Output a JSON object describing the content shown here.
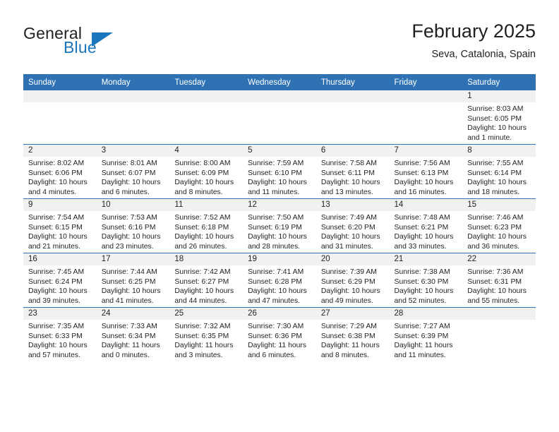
{
  "brand": {
    "name_part1": "General",
    "name_part2": "Blue",
    "triangle_color": "#1b76bc"
  },
  "header": {
    "title": "February 2025",
    "subtitle": "Seva, Catalonia, Spain"
  },
  "theme": {
    "header_bg": "#2f72b4",
    "daynum_bg": "#f1f1f1",
    "text": "#231f20",
    "grid_line": "#2f72b4"
  },
  "weekdays": [
    "Sunday",
    "Monday",
    "Tuesday",
    "Wednesday",
    "Thursday",
    "Friday",
    "Saturday"
  ],
  "labels": {
    "sunrise": "Sunrise:",
    "sunset": "Sunset:",
    "daylight": "Daylight:"
  },
  "weeks": [
    [
      {
        "empty": true
      },
      {
        "empty": true
      },
      {
        "empty": true
      },
      {
        "empty": true
      },
      {
        "empty": true
      },
      {
        "empty": true
      },
      {
        "day": "1",
        "sunrise": "Sunrise: 8:03 AM",
        "sunset": "Sunset: 6:05 PM",
        "daylight1": "Daylight: 10 hours",
        "daylight2": "and 1 minute."
      }
    ],
    [
      {
        "day": "2",
        "sunrise": "Sunrise: 8:02 AM",
        "sunset": "Sunset: 6:06 PM",
        "daylight1": "Daylight: 10 hours",
        "daylight2": "and 4 minutes."
      },
      {
        "day": "3",
        "sunrise": "Sunrise: 8:01 AM",
        "sunset": "Sunset: 6:07 PM",
        "daylight1": "Daylight: 10 hours",
        "daylight2": "and 6 minutes."
      },
      {
        "day": "4",
        "sunrise": "Sunrise: 8:00 AM",
        "sunset": "Sunset: 6:09 PM",
        "daylight1": "Daylight: 10 hours",
        "daylight2": "and 8 minutes."
      },
      {
        "day": "5",
        "sunrise": "Sunrise: 7:59 AM",
        "sunset": "Sunset: 6:10 PM",
        "daylight1": "Daylight: 10 hours",
        "daylight2": "and 11 minutes."
      },
      {
        "day": "6",
        "sunrise": "Sunrise: 7:58 AM",
        "sunset": "Sunset: 6:11 PM",
        "daylight1": "Daylight: 10 hours",
        "daylight2": "and 13 minutes."
      },
      {
        "day": "7",
        "sunrise": "Sunrise: 7:56 AM",
        "sunset": "Sunset: 6:13 PM",
        "daylight1": "Daylight: 10 hours",
        "daylight2": "and 16 minutes."
      },
      {
        "day": "8",
        "sunrise": "Sunrise: 7:55 AM",
        "sunset": "Sunset: 6:14 PM",
        "daylight1": "Daylight: 10 hours",
        "daylight2": "and 18 minutes."
      }
    ],
    [
      {
        "day": "9",
        "sunrise": "Sunrise: 7:54 AM",
        "sunset": "Sunset: 6:15 PM",
        "daylight1": "Daylight: 10 hours",
        "daylight2": "and 21 minutes."
      },
      {
        "day": "10",
        "sunrise": "Sunrise: 7:53 AM",
        "sunset": "Sunset: 6:16 PM",
        "daylight1": "Daylight: 10 hours",
        "daylight2": "and 23 minutes."
      },
      {
        "day": "11",
        "sunrise": "Sunrise: 7:52 AM",
        "sunset": "Sunset: 6:18 PM",
        "daylight1": "Daylight: 10 hours",
        "daylight2": "and 26 minutes."
      },
      {
        "day": "12",
        "sunrise": "Sunrise: 7:50 AM",
        "sunset": "Sunset: 6:19 PM",
        "daylight1": "Daylight: 10 hours",
        "daylight2": "and 28 minutes."
      },
      {
        "day": "13",
        "sunrise": "Sunrise: 7:49 AM",
        "sunset": "Sunset: 6:20 PM",
        "daylight1": "Daylight: 10 hours",
        "daylight2": "and 31 minutes."
      },
      {
        "day": "14",
        "sunrise": "Sunrise: 7:48 AM",
        "sunset": "Sunset: 6:21 PM",
        "daylight1": "Daylight: 10 hours",
        "daylight2": "and 33 minutes."
      },
      {
        "day": "15",
        "sunrise": "Sunrise: 7:46 AM",
        "sunset": "Sunset: 6:23 PM",
        "daylight1": "Daylight: 10 hours",
        "daylight2": "and 36 minutes."
      }
    ],
    [
      {
        "day": "16",
        "sunrise": "Sunrise: 7:45 AM",
        "sunset": "Sunset: 6:24 PM",
        "daylight1": "Daylight: 10 hours",
        "daylight2": "and 39 minutes."
      },
      {
        "day": "17",
        "sunrise": "Sunrise: 7:44 AM",
        "sunset": "Sunset: 6:25 PM",
        "daylight1": "Daylight: 10 hours",
        "daylight2": "and 41 minutes."
      },
      {
        "day": "18",
        "sunrise": "Sunrise: 7:42 AM",
        "sunset": "Sunset: 6:27 PM",
        "daylight1": "Daylight: 10 hours",
        "daylight2": "and 44 minutes."
      },
      {
        "day": "19",
        "sunrise": "Sunrise: 7:41 AM",
        "sunset": "Sunset: 6:28 PM",
        "daylight1": "Daylight: 10 hours",
        "daylight2": "and 47 minutes."
      },
      {
        "day": "20",
        "sunrise": "Sunrise: 7:39 AM",
        "sunset": "Sunset: 6:29 PM",
        "daylight1": "Daylight: 10 hours",
        "daylight2": "and 49 minutes."
      },
      {
        "day": "21",
        "sunrise": "Sunrise: 7:38 AM",
        "sunset": "Sunset: 6:30 PM",
        "daylight1": "Daylight: 10 hours",
        "daylight2": "and 52 minutes."
      },
      {
        "day": "22",
        "sunrise": "Sunrise: 7:36 AM",
        "sunset": "Sunset: 6:31 PM",
        "daylight1": "Daylight: 10 hours",
        "daylight2": "and 55 minutes."
      }
    ],
    [
      {
        "day": "23",
        "sunrise": "Sunrise: 7:35 AM",
        "sunset": "Sunset: 6:33 PM",
        "daylight1": "Daylight: 10 hours",
        "daylight2": "and 57 minutes."
      },
      {
        "day": "24",
        "sunrise": "Sunrise: 7:33 AM",
        "sunset": "Sunset: 6:34 PM",
        "daylight1": "Daylight: 11 hours",
        "daylight2": "and 0 minutes."
      },
      {
        "day": "25",
        "sunrise": "Sunrise: 7:32 AM",
        "sunset": "Sunset: 6:35 PM",
        "daylight1": "Daylight: 11 hours",
        "daylight2": "and 3 minutes."
      },
      {
        "day": "26",
        "sunrise": "Sunrise: 7:30 AM",
        "sunset": "Sunset: 6:36 PM",
        "daylight1": "Daylight: 11 hours",
        "daylight2": "and 6 minutes."
      },
      {
        "day": "27",
        "sunrise": "Sunrise: 7:29 AM",
        "sunset": "Sunset: 6:38 PM",
        "daylight1": "Daylight: 11 hours",
        "daylight2": "and 8 minutes."
      },
      {
        "day": "28",
        "sunrise": "Sunrise: 7:27 AM",
        "sunset": "Sunset: 6:39 PM",
        "daylight1": "Daylight: 11 hours",
        "daylight2": "and 11 minutes."
      },
      {
        "empty": true
      }
    ]
  ]
}
